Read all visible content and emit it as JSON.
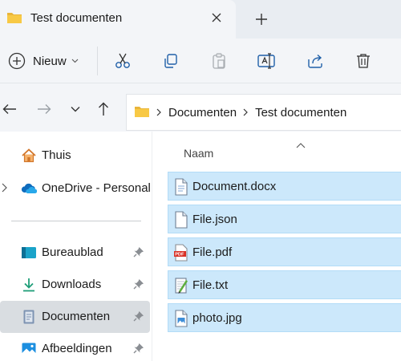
{
  "tab": {
    "title": "Test documenten"
  },
  "toolbar": {
    "new_label": "Nieuw"
  },
  "breadcrumb": [
    "Documenten",
    "Test documenten"
  ],
  "sidebar": {
    "items": [
      {
        "label": "Thuis"
      },
      {
        "label": "OneDrive - Personal"
      },
      {
        "label": "Bureaublad"
      },
      {
        "label": "Downloads"
      },
      {
        "label": "Documenten"
      },
      {
        "label": "Afbeeldingen"
      }
    ]
  },
  "file_list": {
    "column_name": "Naam",
    "files": [
      {
        "name": "Document.docx",
        "icon": "word-doc-icon"
      },
      {
        "name": "File.json",
        "icon": "json-file-icon"
      },
      {
        "name": "File.pdf",
        "icon": "pdf-file-icon"
      },
      {
        "name": "File.txt",
        "icon": "txt-file-icon"
      },
      {
        "name": "photo.jpg",
        "icon": "image-file-icon"
      }
    ]
  },
  "colors": {
    "selection": "#cce8fb",
    "accent": "#0067c0",
    "folder": "#f8c945"
  }
}
